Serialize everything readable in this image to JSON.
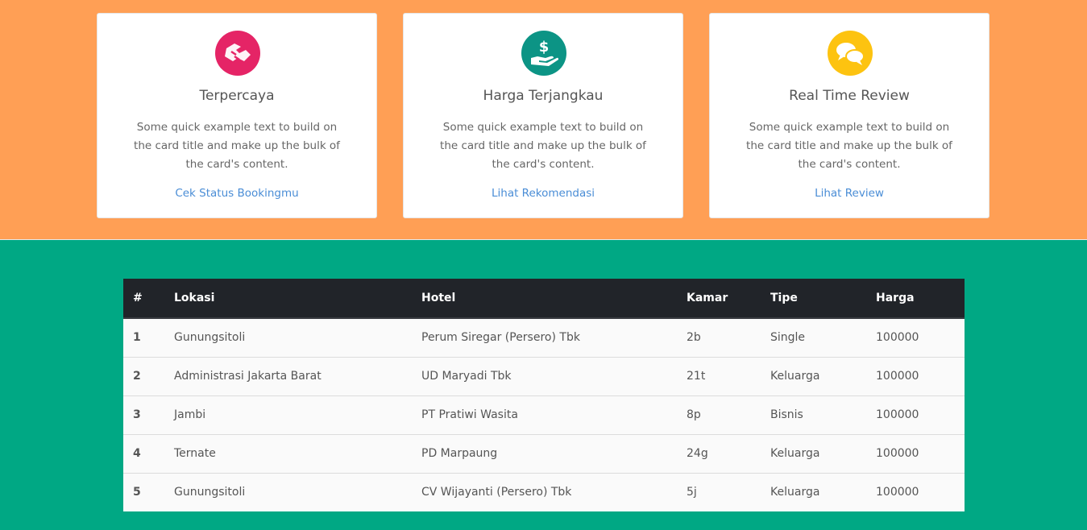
{
  "colors": {
    "top_bg": "#ff9f55",
    "bottom_bg": "#00a884",
    "icon_pink": "#e52466",
    "icon_teal": "#0c9485",
    "icon_yellow": "#fdc310",
    "link": "#4a8dd6"
  },
  "cards": [
    {
      "icon": "handshake-icon",
      "title": "Terpercaya",
      "text": "Some quick example text to build on the card title and make up the bulk of the card's content.",
      "link": "Cek Status Bookingmu"
    },
    {
      "icon": "hand-dollar-icon",
      "title": "Harga Terjangkau",
      "text": "Some quick example text to build on the card title and make up the bulk of the card's content.",
      "link": "Lihat Rekomendasi"
    },
    {
      "icon": "chat-bubbles-icon",
      "title": "Real Time Review",
      "text": "Some quick example text to build on the card title and make up the bulk of the card's content.",
      "link": "Lihat Review"
    }
  ],
  "table": {
    "headers": [
      "#",
      "Lokasi",
      "Hotel",
      "Kamar",
      "Tipe",
      "Harga"
    ],
    "rows": [
      [
        "1",
        "Gunungsitoli",
        "Perum Siregar (Persero) Tbk",
        "2b",
        "Single",
        "100000"
      ],
      [
        "2",
        "Administrasi Jakarta Barat",
        "UD Maryadi Tbk",
        "21t",
        "Keluarga",
        "100000"
      ],
      [
        "3",
        "Jambi",
        "PT Pratiwi Wasita",
        "8p",
        "Bisnis",
        "100000"
      ],
      [
        "4",
        "Ternate",
        "PD Marpaung",
        "24g",
        "Keluarga",
        "100000"
      ],
      [
        "5",
        "Gunungsitoli",
        "CV Wijayanti (Persero) Tbk",
        "5j",
        "Keluarga",
        "100000"
      ]
    ]
  }
}
